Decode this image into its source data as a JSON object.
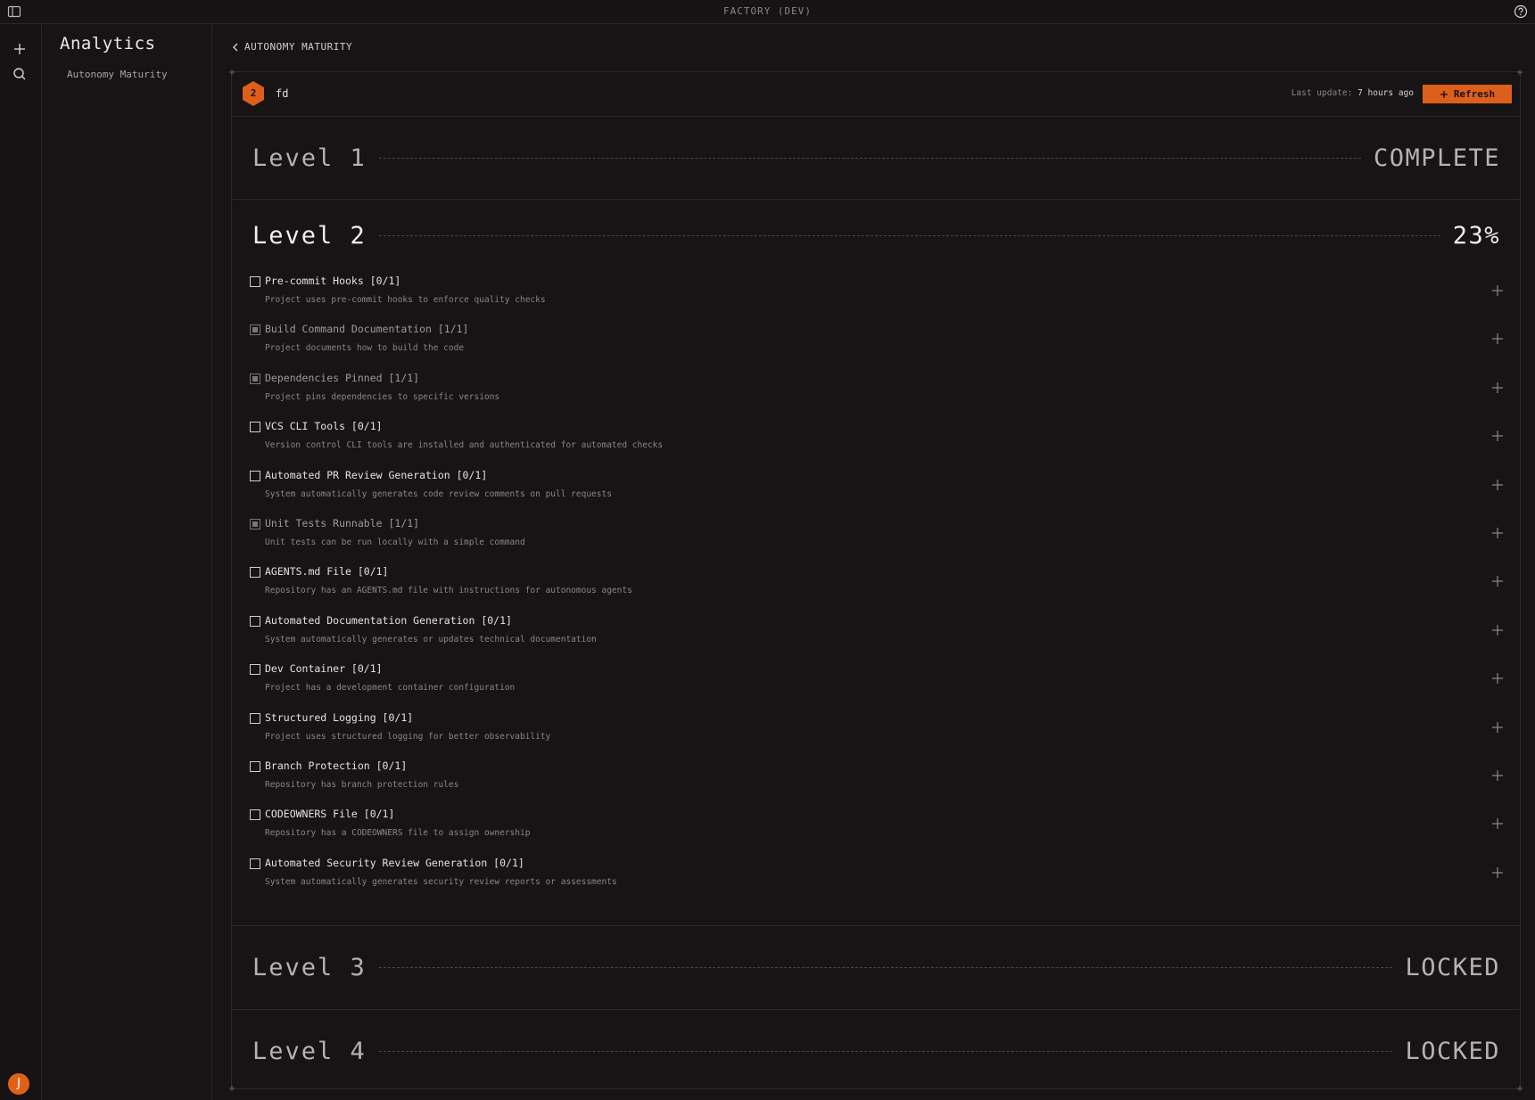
{
  "window": {
    "title": "FACTORY (DEV)"
  },
  "rail": {
    "avatar_initial": "J"
  },
  "sidebar": {
    "heading": "Analytics",
    "items": [
      {
        "label": "Autonomy Maturity"
      }
    ]
  },
  "breadcrumb": {
    "label": "AUTONOMY MATURITY"
  },
  "project": {
    "level_badge": "2",
    "name": "fd",
    "last_update_label": "Last update:",
    "last_update_value": "7 hours ago",
    "refresh_label": "Refresh"
  },
  "colors": {
    "accent": "#de5f1c",
    "background": "#161415",
    "border": "#2c292a"
  },
  "levels": [
    {
      "name": "Level 1",
      "status": "COMPLETE"
    },
    {
      "name": "Level 2",
      "status": "23%",
      "requirements": [
        {
          "title": "Pre-commit Hooks [0/1]",
          "description": "Project uses pre-commit hooks to enforce quality checks",
          "checked": false
        },
        {
          "title": "Build Command Documentation [1/1]",
          "description": "Project documents how to build the code",
          "checked": true
        },
        {
          "title": "Dependencies Pinned [1/1]",
          "description": "Project pins dependencies to specific versions",
          "checked": true
        },
        {
          "title": "VCS CLI Tools [0/1]",
          "description": "Version control CLI tools are installed and authenticated for automated checks",
          "checked": false
        },
        {
          "title": "Automated PR Review Generation [0/1]",
          "description": "System automatically generates code review comments on pull requests",
          "checked": false
        },
        {
          "title": "Unit Tests Runnable [1/1]",
          "description": "Unit tests can be run locally with a simple command",
          "checked": true
        },
        {
          "title": "AGENTS.md File [0/1]",
          "description": "Repository has an AGENTS.md file with instructions for autonomous agents",
          "checked": false
        },
        {
          "title": "Automated Documentation Generation [0/1]",
          "description": "System automatically generates or updates technical documentation",
          "checked": false
        },
        {
          "title": "Dev Container [0/1]",
          "description": "Project has a development container configuration",
          "checked": false
        },
        {
          "title": "Structured Logging [0/1]",
          "description": "Project uses structured logging for better observability",
          "checked": false
        },
        {
          "title": "Branch Protection [0/1]",
          "description": "Repository has branch protection rules",
          "checked": false
        },
        {
          "title": "CODEOWNERS File [0/1]",
          "description": "Repository has a CODEOWNERS file to assign ownership",
          "checked": false
        },
        {
          "title": "Automated Security Review Generation [0/1]",
          "description": "System automatically generates security review reports or assessments",
          "checked": false
        }
      ]
    },
    {
      "name": "Level 3",
      "status": "LOCKED"
    },
    {
      "name": "Level 4",
      "status": "LOCKED"
    }
  ]
}
